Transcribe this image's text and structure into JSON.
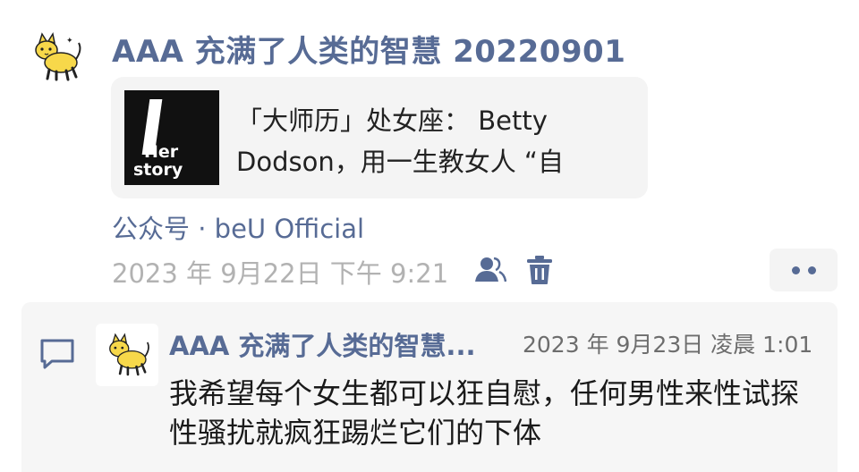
{
  "post": {
    "title": "AAA 充满了人类的智慧 20220901",
    "article": {
      "thumb_text_1": "Her",
      "thumb_text_2": "story",
      "title": "「大师历」处女座： Betty Dodson，用一生教女人 “自"
    },
    "source": "公众号 · beU Official",
    "timestamp": "2023 年 9月22日 下午 9:21",
    "icons": {
      "avatar": "cat-avatar-icon",
      "visibility": "people-icon",
      "delete": "trash-icon",
      "more": "more-dots-icon",
      "comment": "comment-bubble-icon"
    }
  },
  "comment": {
    "author": "AAA 充满了人类的智慧...",
    "time": "2023 年 9月23日 凌晨 1:01",
    "text": "我希望每个女生都可以狂自慰，任何男性来性试探性骚扰就疯狂踢烂它们的下体"
  },
  "colors": {
    "link": "#576b95",
    "meta": "#b2b2b2",
    "card_bg": "#f4f4f4",
    "avatar_yellow": "#f7d84a"
  }
}
